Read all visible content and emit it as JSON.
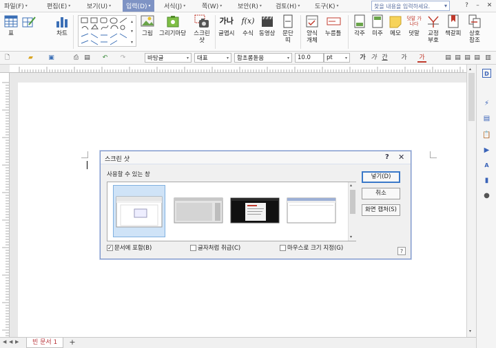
{
  "menu": {
    "items": [
      {
        "label": "파일(F)",
        "x": 0
      },
      {
        "label": "편집(E)",
        "x": 0
      },
      {
        "label": "보기(U)",
        "x": 0
      },
      {
        "label": "입력(D)",
        "x": 0,
        "active": true
      },
      {
        "label": "서식(J)",
        "x": 0
      },
      {
        "label": "쪽(W)",
        "x": 0
      },
      {
        "label": "보안(R)",
        "x": 0
      },
      {
        "label": "검토(H)",
        "x": 0
      },
      {
        "label": "도구(K)",
        "x": 0
      }
    ],
    "search_placeholder": "찾을 내용을 입력하세요.",
    "search_arrow": "▾",
    "window_buttons": [
      "?",
      "–",
      "✕"
    ]
  },
  "ribbon": {
    "table": "표",
    "chart": "차트",
    "picture": "그림",
    "drawing_market": "그리기마당",
    "screenshot": "스크린 샷",
    "glyph": "글맵시",
    "glyph_icon_text": "가나",
    "formula": "수식",
    "formula_icon_text": "f(x)",
    "video": "동영상",
    "paragraph": "문단 띠",
    "form_object": "양식 개체",
    "push_button": "누름틀",
    "footnote": "각주",
    "endnote": "미주",
    "memo": "메모",
    "overlap": "덧말",
    "overlap_icon_text": "덧말 가나다",
    "proof": "교정 부호",
    "bookmark": "책갈피",
    "cross_ref": "상호 참조"
  },
  "format": {
    "style": "바탕글",
    "font_lang": "대표",
    "font_name": "함초롬돋움",
    "font_size": "10.0",
    "unit": "pt",
    "bold": "가",
    "italic": "가",
    "underline": "간",
    "strike": "가",
    "color": "가"
  },
  "tabs": {
    "doc_name": "빈 문서 1",
    "add": "+"
  },
  "dialog": {
    "title": "스크린 샷",
    "help": "?",
    "close": "✕",
    "available_label": "사용할 수 있는 창",
    "checkboxes": [
      {
        "label": "문서에 포함(B)",
        "checked": true
      },
      {
        "label": "글자처럼 취급(C)",
        "checked": false
      },
      {
        "label": "마우스로 크기 지정(G)",
        "checked": false
      }
    ],
    "insert_button": "넣기(D)",
    "cancel_button": "취소",
    "capture_button": "화면 캡처(S)",
    "small_help": "?"
  },
  "colors": {
    "menu_active": "#7e93c4",
    "dialog_border": "#7a93c9",
    "doc_tab_text": "#b8363c",
    "side_icon": "#3a63b8"
  }
}
